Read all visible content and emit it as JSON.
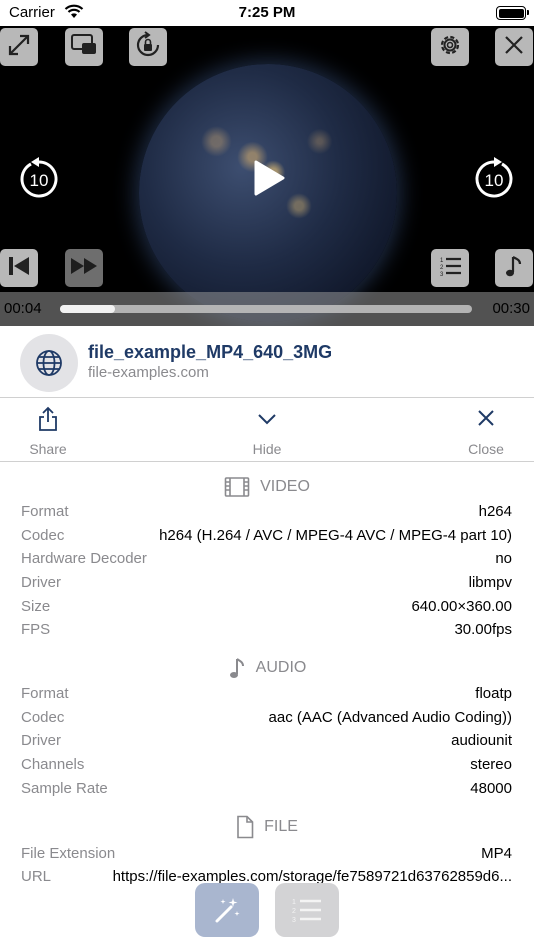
{
  "status_bar": {
    "carrier": "Carrier",
    "time": "7:25 PM"
  },
  "player": {
    "current_time": "00:04",
    "duration": "00:30",
    "progress": 0.133,
    "skip_back_seconds": "10",
    "skip_forward_seconds": "10",
    "icons": [
      "fullscreen-icon",
      "picture-in-picture-icon",
      "rotation-lock-icon",
      "gear-icon",
      "close-icon",
      "replay-10-icon",
      "play-icon",
      "forward-10-icon",
      "previous-track-icon",
      "fast-forward-icon",
      "playlist-icon",
      "music-note-icon"
    ]
  },
  "media": {
    "title": "file_example_MP4_640_3MG",
    "source": "file-examples.com"
  },
  "actions": {
    "share": "Share",
    "hide": "Hide",
    "close": "Close"
  },
  "video": {
    "heading": "VIDEO",
    "rows": [
      {
        "key": "Format",
        "value": "h264"
      },
      {
        "key": "Codec",
        "value": "h264 (H.264 / AVC / MPEG-4 AVC / MPEG-4 part 10)"
      },
      {
        "key": "Hardware Decoder",
        "value": "no"
      },
      {
        "key": "Driver",
        "value": "libmpv"
      },
      {
        "key": "Size",
        "value": "640.00×360.00"
      },
      {
        "key": "FPS",
        "value": "30.00fps"
      }
    ]
  },
  "audio": {
    "heading": "AUDIO",
    "rows": [
      {
        "key": "Format",
        "value": "floatp"
      },
      {
        "key": "Codec",
        "value": "aac (AAC (Advanced Audio Coding))"
      },
      {
        "key": "Driver",
        "value": "audiounit"
      },
      {
        "key": "Channels",
        "value": "stereo"
      },
      {
        "key": "Sample Rate",
        "value": "48000"
      }
    ]
  },
  "file": {
    "heading": "FILE",
    "rows": [
      {
        "key": "File Extension",
        "value": "MP4"
      },
      {
        "key": "URL",
        "value": "https://file-examples.com/storage/fe7589721d63762859d6..."
      }
    ]
  },
  "colors": {
    "accent": "#1f3a66",
    "secondary_text": "#8a8a8e",
    "wand_button": "#a9b6cf"
  }
}
